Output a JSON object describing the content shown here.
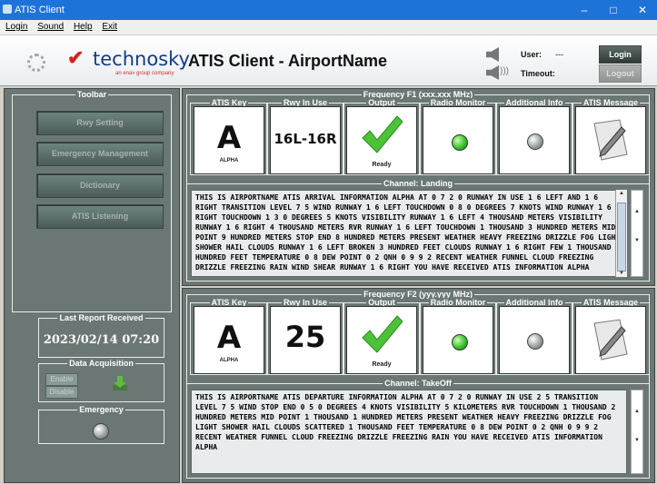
{
  "window": {
    "title": "ATIS Client",
    "minimize": "–",
    "maximize": "□",
    "close": "✕"
  },
  "menu": [
    "Login",
    "Sound",
    "Help",
    "Exit"
  ],
  "header": {
    "logo_text": "technosky",
    "logo_sub": "an enav group company",
    "title": "ATIS Client - AirportName",
    "user_label": "User:",
    "user_value": "---",
    "timeout_label": "Timeout:",
    "login_btn": "Login",
    "logout_btn": "Logout"
  },
  "toolbar": {
    "label": "Toolbar",
    "buttons": [
      "Rwy Setting",
      "Emergency Management",
      "Dictionary",
      "ATIS Listening"
    ]
  },
  "last_report": {
    "label": "Last Report Received",
    "value": "2023/02/14 07:20"
  },
  "data_acq": {
    "label": "Data Acquisition",
    "enable": "Enable",
    "disable": "Disable"
  },
  "emergency": {
    "label": "Emergency"
  },
  "cards_labels": {
    "key": "ATIS Key",
    "rwy": "Rwy In Use",
    "output": "Output",
    "radio": "Radio Monitor",
    "info": "Additional Info",
    "msg": "ATIS Message"
  },
  "f1": {
    "label": "Frequency F1 (xxx.xxx MHz)",
    "atis_key": "A",
    "atis_word": "ALPHA",
    "rwy": "16L-16R",
    "output_status": "Ready",
    "channel_label": "Channel: Landing",
    "text": "THIS IS AIRPORTNAME ATIS ARRIVAL INFORMATION ALPHA AT 0 7 2 0 RUNWAY IN USE 1 6 LEFT AND 1 6 RIGHT TRANSITION LEVEL 7 5 WIND RUNWAY 1 6 LEFT TOUCHDOWN 0 8 0 DEGREES 7 KNOTS WIND RUNWAY 1 6 RIGHT TOUCHDOWN 1 3 0 DEGREES 5 KNOTS VISIBILITY RUNWAY 1 6 LEFT 4 THOUSAND METERS VISIBILITY RUNWAY 1 6 RIGHT 4 THOUSAND METERS RVR RUNWAY 1 6 LEFT TOUCHDOWN 1 THOUSAND 3 HUNDRED METERS MID POINT 9 HUNDRED METERS STOP END 8 HUNDRED METERS PRESENT WEATHER HEAVY FREEZING DRIZZLE FOG LIGHT SHOWER HAIL CLOUDS RUNWAY 1 6 LEFT BROKEN 3 HUNDRED FEET CLOUDS RUNWAY 1 6 RIGHT FEW 1 THOUSAND 3 HUNDRED FEET TEMPERATURE 0 8 DEW POINT 0 2 QNH 0 9 9 2 RECENT WEATHER FUNNEL CLOUD FREEZING DRIZZLE FREEZING RAIN WIND SHEAR RUNWAY 1 6 RIGHT YOU HAVE RECEIVED ATIS INFORMATION ALPHA"
  },
  "f2": {
    "label": "Frequency F2 (yyy.yyy MHz)",
    "atis_key": "A",
    "atis_word": "ALPHA",
    "rwy": "25",
    "output_status": "Ready",
    "channel_label": "Channel: TakeOff",
    "text": "THIS IS AIRPORTNAME ATIS DEPARTURE INFORMATION ALPHA AT 0 7 2 0 RUNWAY IN USE 2 5 TRANSITION LEVEL 7 5 WIND STOP END 0 5 0 DEGREES 4 KNOTS VISIBILITY 5 KILOMETERS RVR TOUCHDOWN 1 THOUSAND 2 HUNDRED METERS MID POINT 1 THOUSAND 1 HUNDRED METERS PRESENT WEATHER HEAVY FREEZING DRIZZLE FOG LIGHT SHOWER HAIL CLOUDS SCATTERED 1 THOUSAND FEET TEMPERATURE 0 8 DEW POINT 0 2 QNH 0 9 9 2 RECENT WEATHER FUNNEL CLOUD FREEZING DRIZZLE FREEZING RAIN YOU HAVE RECEIVED ATIS INFORMATION ALPHA"
  }
}
